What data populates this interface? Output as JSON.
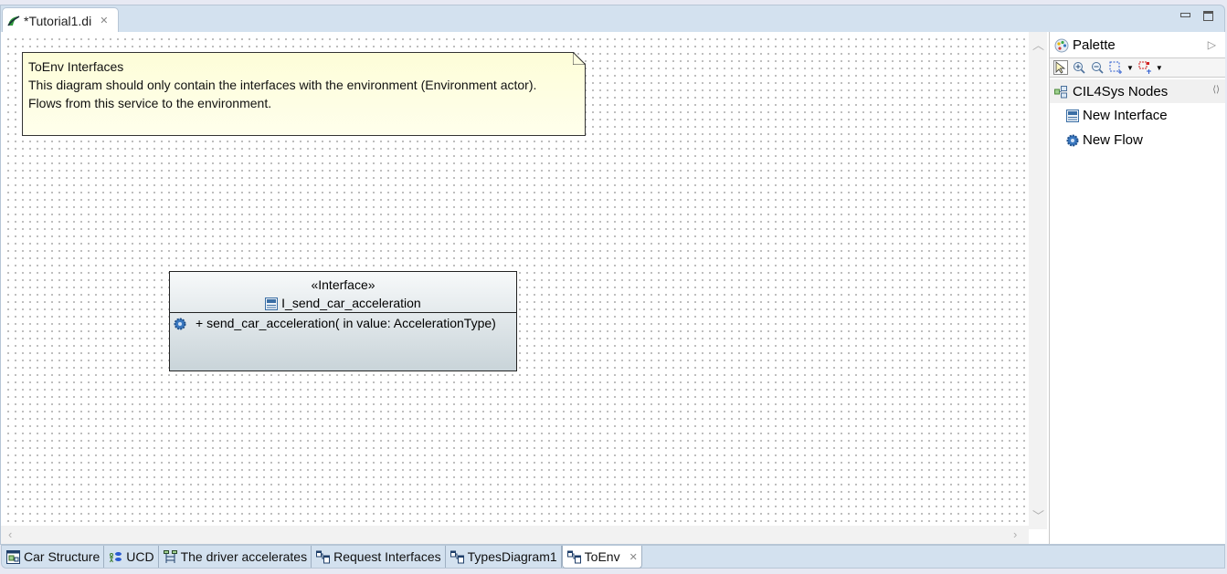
{
  "editor": {
    "tab_title": "*Tutorial1.di",
    "tab_icon": "papyrus-leaf-icon"
  },
  "window_controls": {
    "minimize": "minimize-icon",
    "maximize": "maximize-icon"
  },
  "diagram": {
    "note": {
      "lines": [
        "ToEnv Interfaces",
        "This diagram should only contain the interfaces with the environment (Environment actor).",
        "Flows from this service to the environment."
      ]
    },
    "interface": {
      "stereotype": "«Interface»",
      "name": "I_send_car_acceleration",
      "operations": [
        {
          "icon": "flow-gear-icon",
          "label": "+ send_car_acceleration(  in value: AccelerationType)"
        }
      ]
    }
  },
  "palette": {
    "title": "Palette",
    "tools": [
      "select-tool",
      "zoom-in-tool",
      "zoom-out-tool",
      "marquee-tool",
      "connection-marquee-tool"
    ],
    "drawer": {
      "label": "CIL4Sys Nodes",
      "items": [
        {
          "label": "New Interface",
          "icon": "interface-icon"
        },
        {
          "label": "New Flow",
          "icon": "flow-gear-icon"
        }
      ]
    }
  },
  "bottom_tabs": [
    {
      "label": "Car Structure",
      "icon": "composite-diagram-icon",
      "active": false
    },
    {
      "label": "UCD",
      "icon": "use-case-diagram-icon",
      "active": false
    },
    {
      "label": "The driver accelerates",
      "icon": "sequence-diagram-icon",
      "active": false
    },
    {
      "label": "Request Interfaces",
      "icon": "class-diagram-icon",
      "active": false
    },
    {
      "label": "TypesDiagram1",
      "icon": "class-diagram-icon",
      "active": false
    },
    {
      "label": "ToEnv",
      "icon": "class-diagram-icon",
      "active": true
    }
  ]
}
